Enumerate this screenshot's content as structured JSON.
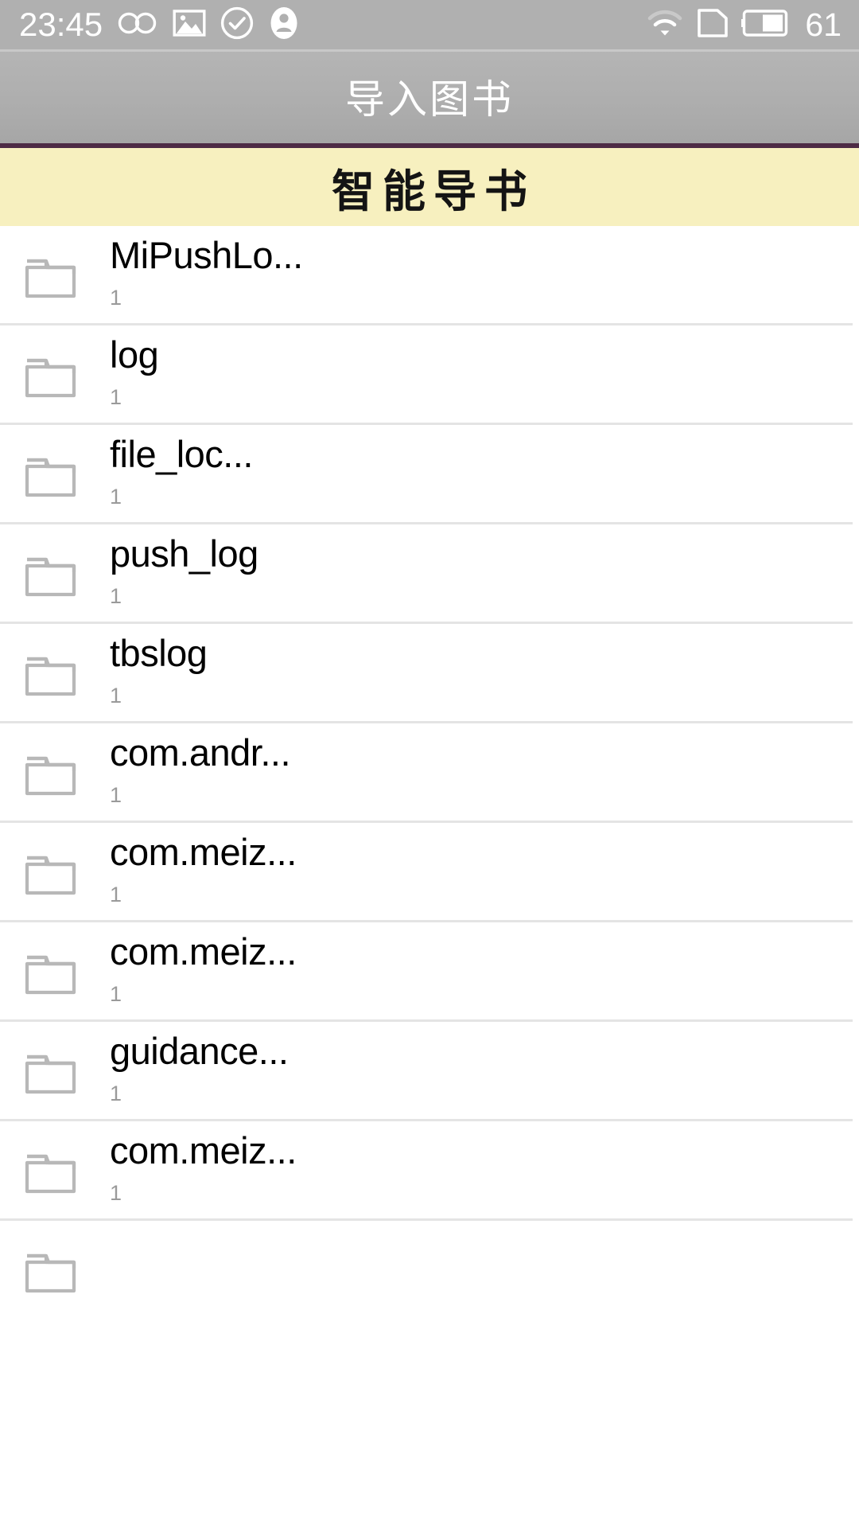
{
  "status_bar": {
    "time": "23:45",
    "battery_percent": "61",
    "left_icons": [
      "infinity-icon",
      "photo-icon",
      "check-circle-icon",
      "account-icon"
    ],
    "right_icons": [
      "wifi-icon",
      "sim-card-icon",
      "battery-icon"
    ],
    "background_color": "#b0b0b0",
    "foreground_color": "#ffffff"
  },
  "app_bar": {
    "title": "导入图书",
    "background_color": "#aeaeae",
    "text_color": "#ffffff"
  },
  "banner": {
    "title": "智能导书",
    "background_color": "#f7f0bf",
    "border_color": "#4e2b45",
    "text_color": "#141414"
  },
  "list": {
    "icon": "folder-icon",
    "items": [
      {
        "name": "MiPushLo...",
        "count": "1"
      },
      {
        "name": "log",
        "count": "1"
      },
      {
        "name": "file_loc...",
        "count": "1"
      },
      {
        "name": "push_log",
        "count": "1"
      },
      {
        "name": "tbslog",
        "count": "1"
      },
      {
        "name": "com.andr...",
        "count": "1"
      },
      {
        "name": "com.meiz...",
        "count": "1"
      },
      {
        "name": "com.meiz...",
        "count": "1"
      },
      {
        "name": "guidance...",
        "count": "1"
      },
      {
        "name": "com.meiz...",
        "count": "1"
      },
      {
        "name": "",
        "count": ""
      }
    ],
    "divider_color": "#e4e4e4",
    "title_color": "#000000",
    "count_color": "#9a9a9a"
  }
}
